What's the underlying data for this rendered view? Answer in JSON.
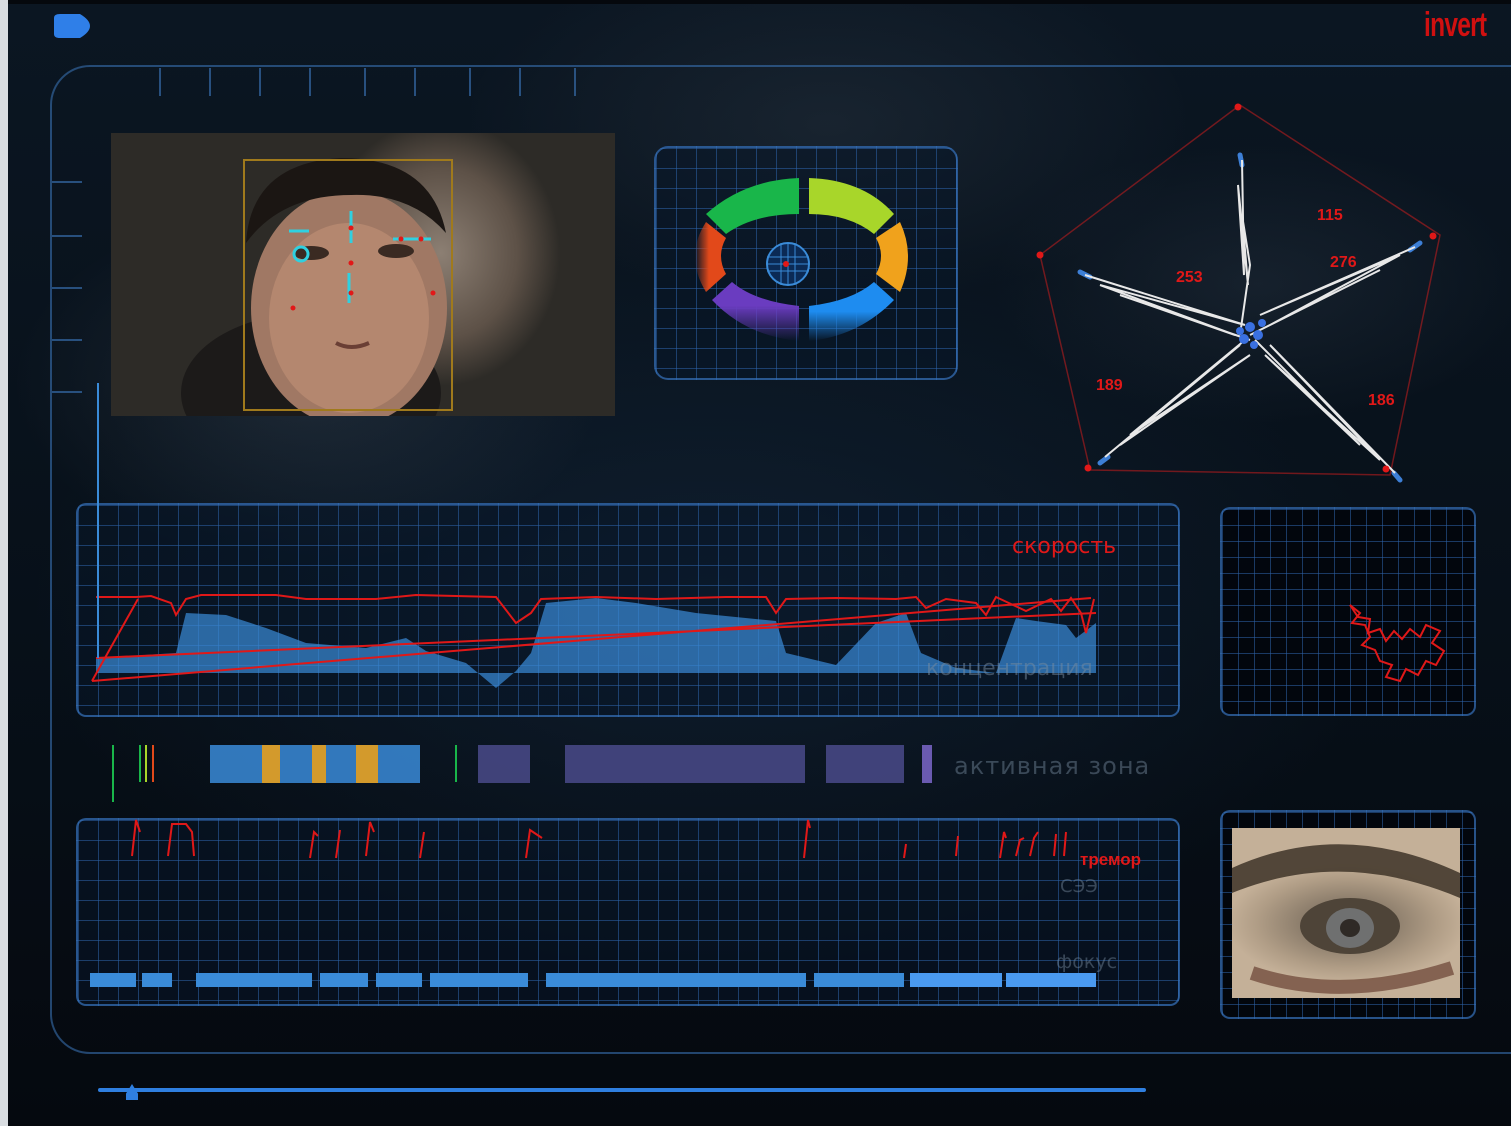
{
  "header": {
    "invert_label": "invert",
    "menu_icon": "blue-tab-icon"
  },
  "video": {
    "subject": "face-camera-feed",
    "tracking_box_color": "#a07a1c",
    "tracking_marker_color": "#2fd0e0"
  },
  "emotion_wheel": {
    "segments": [
      "#19b64a",
      "#a8d62a",
      "#f0a21c",
      "#1e8cf0",
      "#6a3cc0",
      "#e2491a"
    ],
    "center_icon": "target-icon"
  },
  "star_plot": {
    "values": [
      "115",
      "276",
      "186",
      "189",
      "253"
    ]
  },
  "speed_chart": {
    "label": "скорость",
    "sublabel": "концентрация",
    "line_color": "#e01818",
    "area_color": "#3a8bd8"
  },
  "active_zone": {
    "label": "активная зона"
  },
  "tremor_chart": {
    "label": "тремор",
    "sublabel_1": "СЭЭ",
    "sublabel_2": "фокус"
  },
  "trace_panel": {
    "trace_color": "#e01818"
  },
  "eye_panel": {
    "subject": "eye-closeup"
  },
  "timeline": {
    "position": 0.03
  }
}
